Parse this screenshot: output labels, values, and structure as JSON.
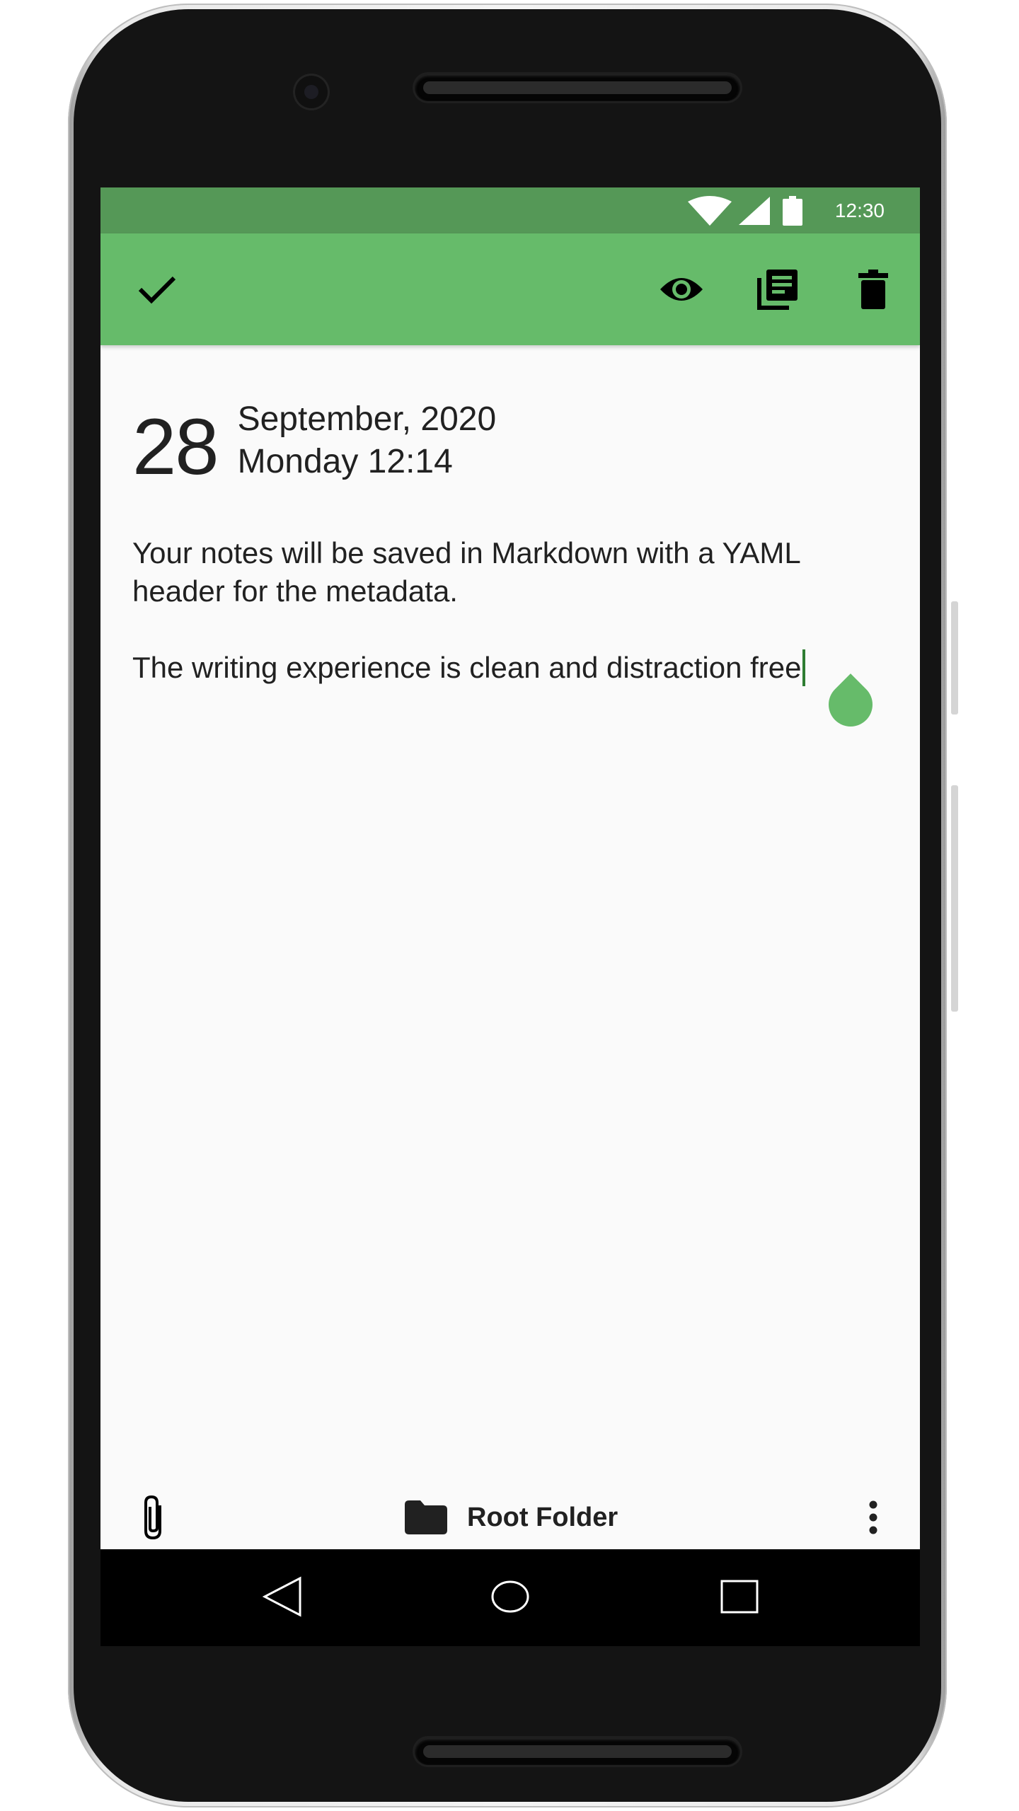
{
  "status_bar": {
    "time": "12:30",
    "icons": [
      "wifi-icon",
      "signal-icon",
      "battery-icon"
    ],
    "color": "#559857"
  },
  "toolbar": {
    "color": "#66bb6a",
    "actions": [
      "check-icon",
      "eye-icon",
      "library-books-icon",
      "delete-icon"
    ]
  },
  "note": {
    "day": "28",
    "month_year": "September, 2020",
    "weekday_time": "Monday 12:14",
    "paragraphs": [
      "Your notes will be saved in Markdown with a YAML header for the metadata.",
      "The writing experience is clean and distraction free"
    ]
  },
  "bottom_bar": {
    "folder_label": "Root Folder",
    "icons": [
      "paperclip-icon",
      "folder-icon",
      "more-vertical-icon"
    ]
  },
  "nav_bar": {
    "buttons": [
      "back-icon",
      "home-icon",
      "recents-icon"
    ]
  }
}
